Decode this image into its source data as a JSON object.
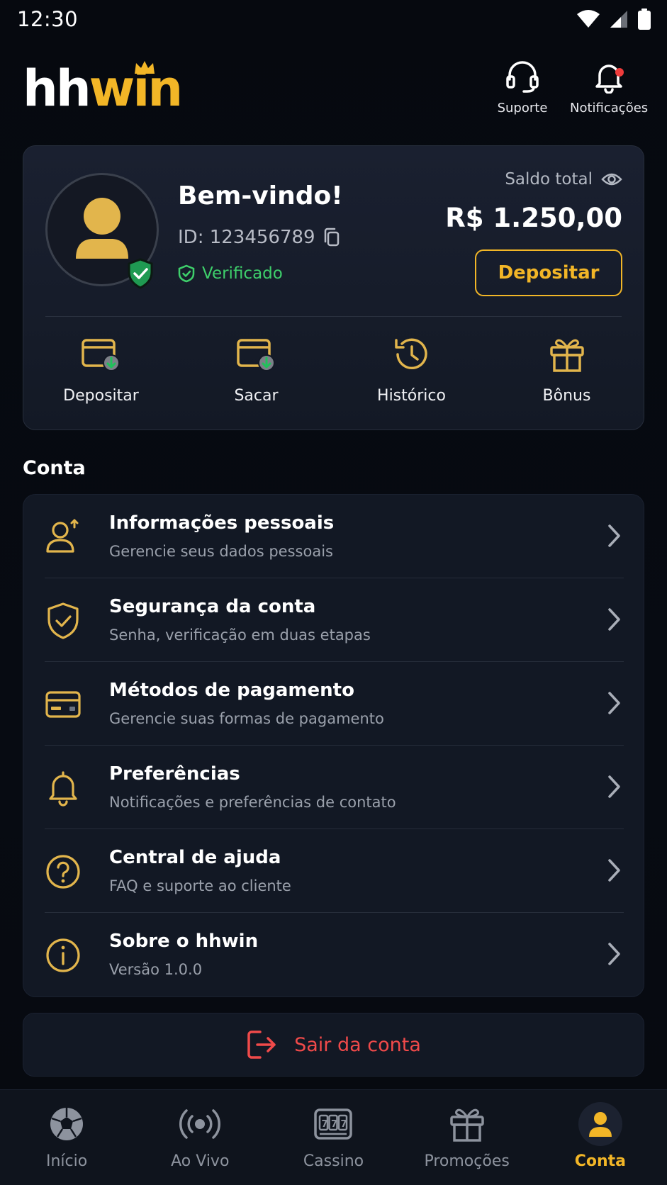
{
  "status_bar": {
    "time": "12:30"
  },
  "header": {
    "logo_part1": "hh",
    "logo_part2": "win",
    "support_label": "Suporte",
    "notifications_label": "Notificações"
  },
  "profile": {
    "welcome": "Bem-vindo!",
    "user_id": "ID: 123456789",
    "verified_label": "Verificado",
    "balance_label": "Saldo total",
    "balance_value": "R$ 1.250,00",
    "deposit_button": "Depositar"
  },
  "quick_actions": [
    {
      "label": "Depositar",
      "icon": "wallet-deposit-icon"
    },
    {
      "label": "Sacar",
      "icon": "wallet-withdraw-icon"
    },
    {
      "label": "Histórico",
      "icon": "history-icon"
    },
    {
      "label": "Bônus",
      "icon": "gift-icon"
    }
  ],
  "section_title": "Conta",
  "menu": [
    {
      "title": "Informações pessoais",
      "subtitle": "Gerencie seus dados pessoais",
      "icon": "user-edit-icon"
    },
    {
      "title": "Segurança da conta",
      "subtitle": "Senha, verificação em duas etapas",
      "icon": "shield-check-icon"
    },
    {
      "title": "Métodos de pagamento",
      "subtitle": "Gerencie suas formas de pagamento",
      "icon": "credit-card-icon"
    },
    {
      "title": "Preferências",
      "subtitle": "Notificações e preferências de contato",
      "icon": "bell-icon"
    },
    {
      "title": "Central de ajuda",
      "subtitle": "FAQ e suporte ao cliente",
      "icon": "help-circle-icon"
    },
    {
      "title": "Sobre o hhwin",
      "subtitle": "Versão 1.0.0",
      "icon": "info-circle-icon"
    }
  ],
  "logout_label": "Sair da conta",
  "bottom_nav": [
    {
      "label": "Início",
      "icon": "soccer-ball-icon",
      "active": false
    },
    {
      "label": "Ao Vivo",
      "icon": "live-broadcast-icon",
      "active": false
    },
    {
      "label": "Cassino",
      "icon": "slot-machine-icon",
      "active": false
    },
    {
      "label": "Promoções",
      "icon": "gift-icon",
      "active": false
    },
    {
      "label": "Conta",
      "icon": "user-icon",
      "active": true
    }
  ],
  "colors": {
    "accent": "#f2b627",
    "success": "#3ecf6b",
    "danger": "#f04a4a",
    "background": "#06090f",
    "card": "#121824"
  }
}
